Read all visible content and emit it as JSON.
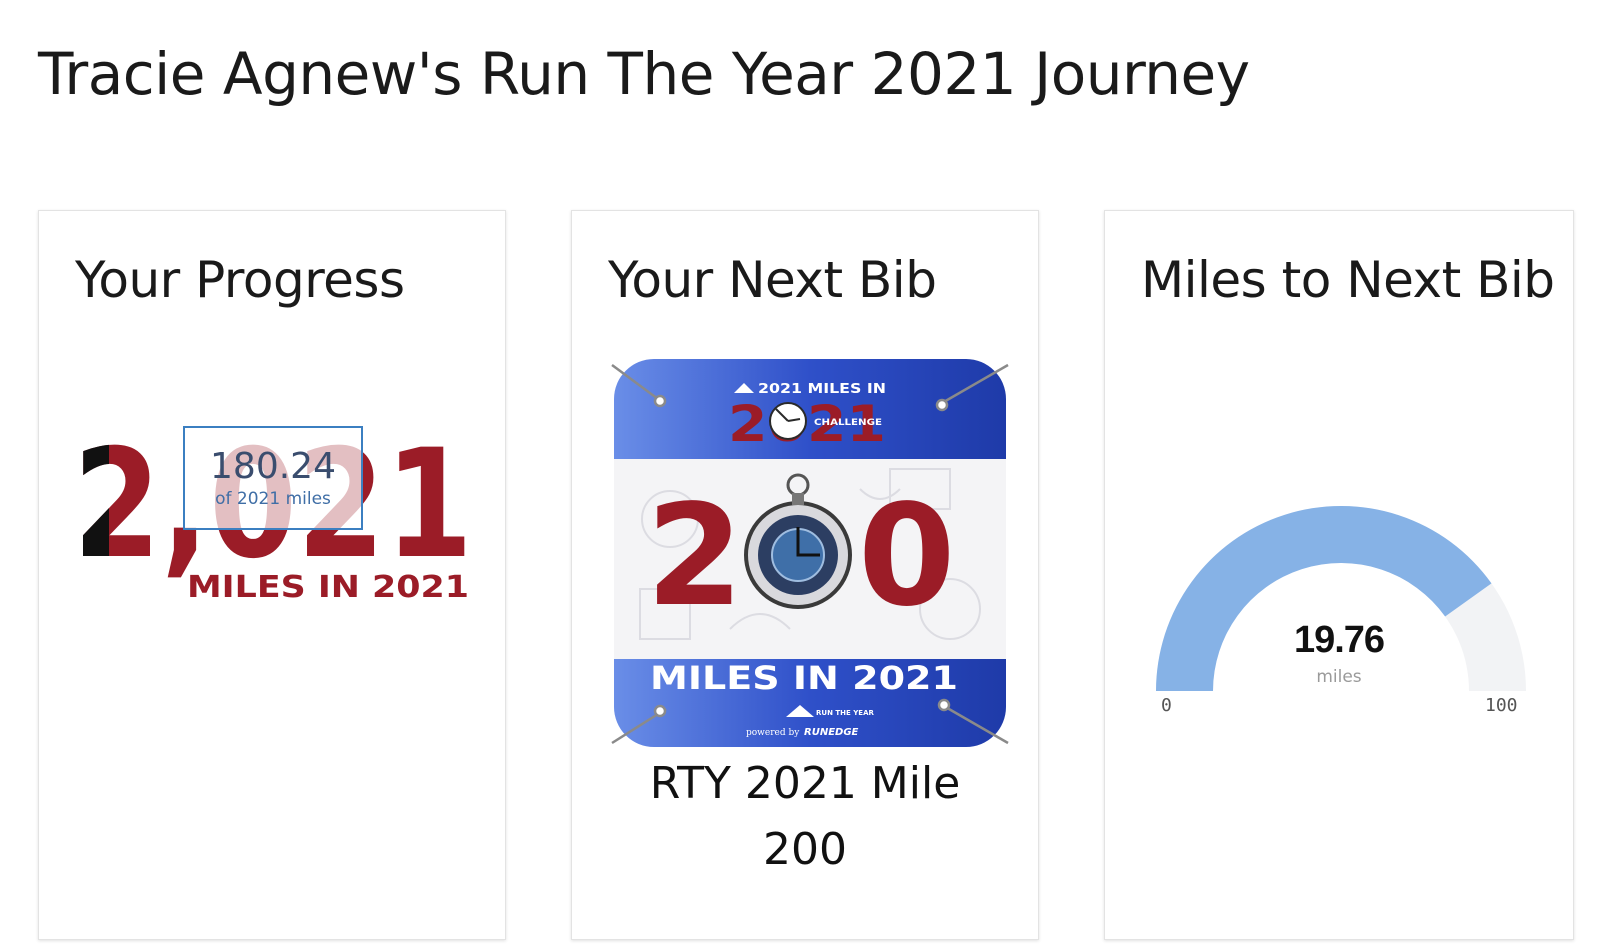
{
  "page": {
    "title": "Tracie Agnew's Run The Year 2021 Journey"
  },
  "progress_card": {
    "title": "Your Progress",
    "value": "180.24",
    "subtitle": "of 2021 miles",
    "art_number": "2,021",
    "art_caption": "MILES IN 2021"
  },
  "bib_card": {
    "title": "Your Next Bib",
    "caption_line1": "RTY 2021 Mile",
    "caption_line2": "200",
    "bib_top_text": "2021 MILES IN",
    "bib_top_year": "2021",
    "bib_challenge": "CHALLENGE",
    "bib_number_left": "2",
    "bib_number_right": "0",
    "bib_bottom_text": "MILES IN 2021",
    "bib_logo_text": "RUN THE YEAR",
    "bib_powered": "powered by",
    "bib_brand": "RUNEDGE"
  },
  "gauge_card": {
    "title": "Miles to Next Bib",
    "value": "19.76",
    "unit": "miles",
    "min": "0",
    "max": "100",
    "level_fraction": 0.8024
  },
  "colors": {
    "bib_red": "#9b1c27",
    "bib_blue": "#2b4fc8",
    "gauge_fill": "#86b2e6",
    "gauge_track": "#f2f3f5",
    "progress_black": "#111111"
  }
}
